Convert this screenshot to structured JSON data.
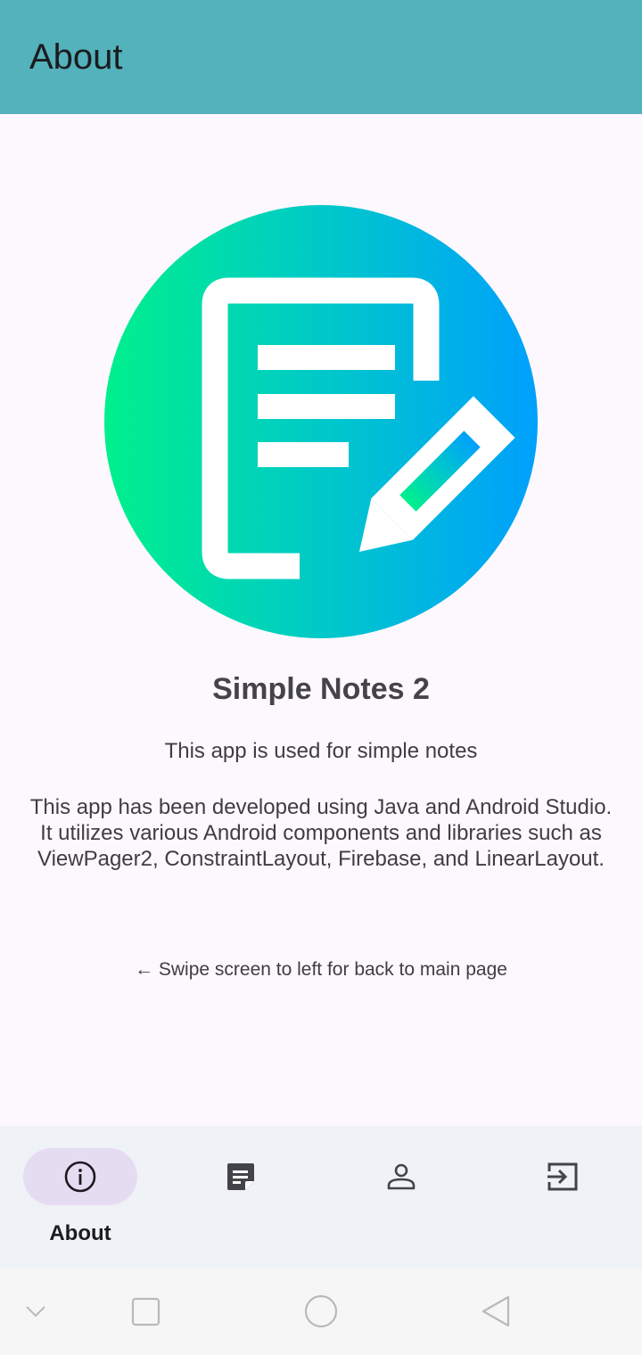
{
  "app_bar": {
    "title": "About"
  },
  "about": {
    "logo": "notes-edit-logo-icon",
    "app_name": "Simple Notes 2",
    "tagline": "This app is used for simple notes",
    "description": "This app has been developed using Java and Android Studio. It utilizes various Android components and libraries such as ViewPager2, ConstraintLayout, Firebase, and LinearLayout.",
    "swipe_hint": "← Swipe screen to left for back to main page"
  },
  "bottom_nav": {
    "items": [
      {
        "label": "About",
        "icon": "info-icon",
        "selected": true
      },
      {
        "label": "",
        "icon": "notes-icon",
        "selected": false
      },
      {
        "label": "",
        "icon": "person-icon",
        "selected": false
      },
      {
        "label": "",
        "icon": "logout-icon",
        "selected": false
      }
    ]
  },
  "system_nav": {
    "buttons": [
      "chevron-down-icon",
      "recents-icon",
      "home-icon",
      "back-icon"
    ]
  },
  "colors": {
    "app_bar": "#53b2bb",
    "background": "#fdf8fd",
    "nav_background": "#eff2f6",
    "nav_pill": "#e6dcf2",
    "logo_gradient_start": "#00f08c",
    "logo_gradient_mid": "#00c9c9",
    "logo_gradient_end": "#00a0fc"
  }
}
